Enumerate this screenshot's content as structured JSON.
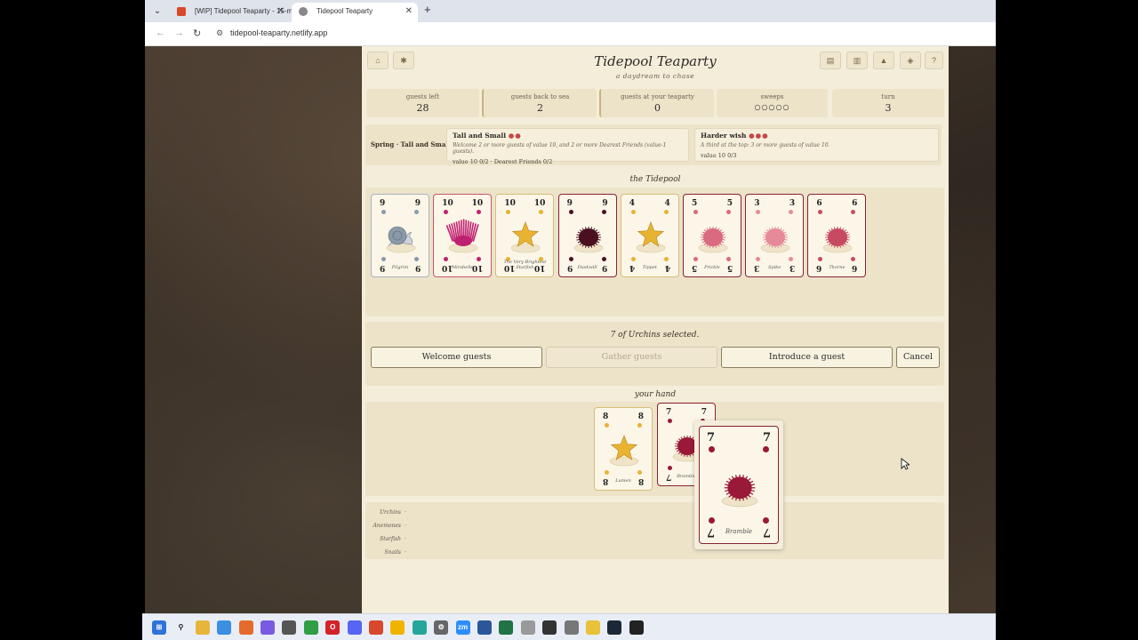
{
  "browser": {
    "tabs": [
      {
        "label": "[WIP] Tidepool Teaparty - 15-m",
        "active": false
      },
      {
        "label": "Tidepool Teaparty",
        "active": true
      }
    ],
    "url": "tidepool-teaparty.netlify.app"
  },
  "game": {
    "title": "Tidepool Teaparty",
    "subtitle": "a daydream to chase",
    "stats": [
      {
        "label": "guests left",
        "value": "28"
      },
      {
        "label": "guests back to sea",
        "value": "2"
      },
      {
        "label": "guests at your teaparty",
        "value": "0"
      },
      {
        "label": "sweeps",
        "value": "○○○○○"
      },
      {
        "label": "turn",
        "value": "3"
      }
    ],
    "season": "Spring · Tall and Small",
    "goals": [
      {
        "title": "Tall and Small",
        "dots": "●●",
        "desc": "Welcome 2 or more guests of value 10, and 2 or more Dearest Friends (value-1 guests).",
        "progress": "value 10 0/2 · Dearest Friends 0/2"
      },
      {
        "title": "Harder wish",
        "dots": "●●●",
        "desc": "A third at the top: 3 or more guests of value 10.",
        "progress": "value 10 0/3"
      }
    ],
    "pool_title": "the Tidepool",
    "pool": [
      {
        "value": "9",
        "kind": "snail",
        "name": "Pilgrim",
        "color": "#8a9aa8"
      },
      {
        "value": "10",
        "kind": "anemone",
        "name": "Mirabelle",
        "color": "#c02070"
      },
      {
        "value": "10",
        "kind": "star",
        "name": "The Very Brightest Starfish",
        "color": "#e9b332"
      },
      {
        "value": "9",
        "kind": "urchin",
        "name": "Duskwill",
        "color": "#4a1020"
      },
      {
        "value": "4",
        "kind": "star",
        "name": "Tippet",
        "color": "#e9b332"
      },
      {
        "value": "5",
        "kind": "urchin",
        "name": "Prickle",
        "color": "#d96a80"
      },
      {
        "value": "3",
        "kind": "urchin",
        "name": "Spike",
        "color": "#e68a9a"
      },
      {
        "value": "6",
        "kind": "urchin",
        "name": "Thorne",
        "color": "#c84a62"
      }
    ],
    "selection_message": "7 of Urchins selected.",
    "actions": [
      {
        "label": "Welcome guests",
        "enabled": true
      },
      {
        "label": "Gather guests",
        "enabled": false
      },
      {
        "label": "Introduce a guest",
        "enabled": true
      },
      {
        "label": "Cancel",
        "enabled": true
      }
    ],
    "hand_title": "your hand",
    "hand": [
      {
        "value": "8",
        "kind": "star",
        "name": "Lumen",
        "color": "#e9b332"
      },
      {
        "value": "7",
        "kind": "urchin",
        "name": "Bramble",
        "color": "#9a1838"
      }
    ],
    "zoom_card": {
      "value": "7",
      "kind": "urchin",
      "name": "Bramble",
      "color": "#9a1838"
    },
    "tally": [
      {
        "label": "Urchins",
        "value": "-"
      },
      {
        "label": "Anemones",
        "value": "-"
      },
      {
        "label": "Starfish",
        "value": "-"
      },
      {
        "label": "Snails",
        "value": "-"
      }
    ]
  }
}
